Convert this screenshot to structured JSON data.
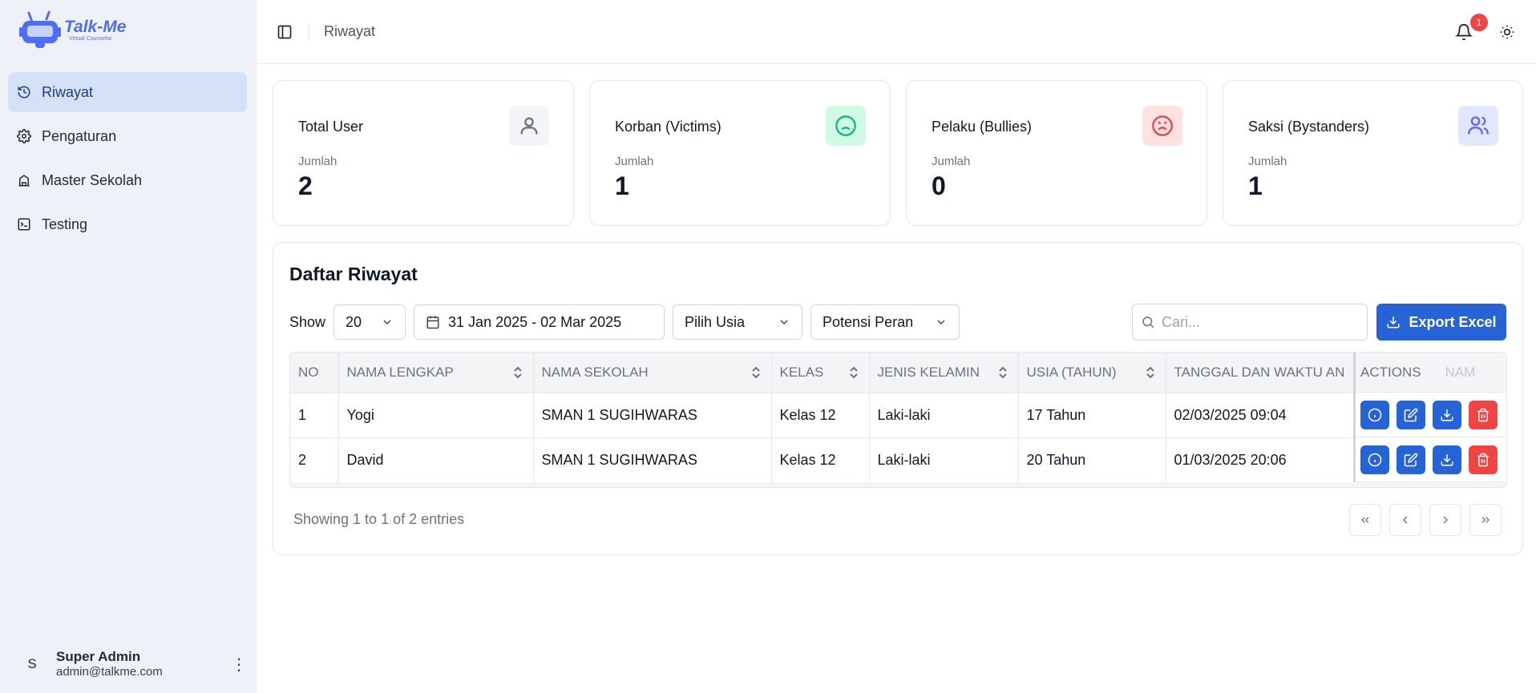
{
  "app": {
    "brand": "Talk-Me",
    "tagline": "Virtual Counselor"
  },
  "sidebar": {
    "items": [
      {
        "label": "Riwayat",
        "icon": "history-icon",
        "active": true
      },
      {
        "label": "Pengaturan",
        "icon": "gear-icon",
        "active": false
      },
      {
        "label": "Master Sekolah",
        "icon": "school-icon",
        "active": false
      },
      {
        "label": "Testing",
        "icon": "terminal-icon",
        "active": false
      }
    ],
    "user": {
      "initial": "S",
      "name": "Super Admin",
      "email": "admin@talkme.com"
    }
  },
  "header": {
    "breadcrumb": "Riwayat",
    "notification_count": "1"
  },
  "stats": [
    {
      "title": "Total User",
      "label": "Jumlah",
      "value": "2",
      "icon": "user-icon",
      "color": "#6b7280"
    },
    {
      "title": "Korban (Victims)",
      "label": "Jumlah",
      "value": "1",
      "icon": "sad-face-icon",
      "color": "#10b981"
    },
    {
      "title": "Pelaku (Bullies)",
      "label": "Jumlah",
      "value": "0",
      "icon": "angry-face-icon",
      "color": "#ef4444"
    },
    {
      "title": "Saksi (Bystanders)",
      "label": "Jumlah",
      "value": "1",
      "icon": "users-icon",
      "color": "#6366f1"
    }
  ],
  "table_card": {
    "title": "Daftar Riwayat",
    "show_label": "Show",
    "page_size": "20",
    "date_range": "31 Jan 2025 - 02 Mar 2025",
    "age_filter": "Pilih Usia",
    "role_filter": "Potensi Peran",
    "search_placeholder": "Cari...",
    "export_label": "Export Excel",
    "columns": [
      "NO",
      "NAMA LENGKAP",
      "NAMA SEKOLAH",
      "KELAS",
      "JENIS KELAMIN",
      "USIA (TAHUN)",
      "TANGGAL DAN WAKTU AN"
    ],
    "actions_header": "ACTIONS",
    "actions_overflow": "NAM",
    "rows": [
      {
        "no": "1",
        "nama": "Yogi",
        "sekolah": "SMAN 1 SUGIHWARAS",
        "kelas": "Kelas 12",
        "jk": "Laki-laki",
        "usia": "17 Tahun",
        "tanggal": "02/03/2025 09:04"
      },
      {
        "no": "2",
        "nama": "David",
        "sekolah": "SMAN 1 SUGIHWARAS",
        "kelas": "Kelas 12",
        "jk": "Laki-laki",
        "usia": "20 Tahun",
        "tanggal": "01/03/2025 20:06"
      }
    ],
    "entries_text": "Showing 1 to 1 of 2 entries"
  }
}
